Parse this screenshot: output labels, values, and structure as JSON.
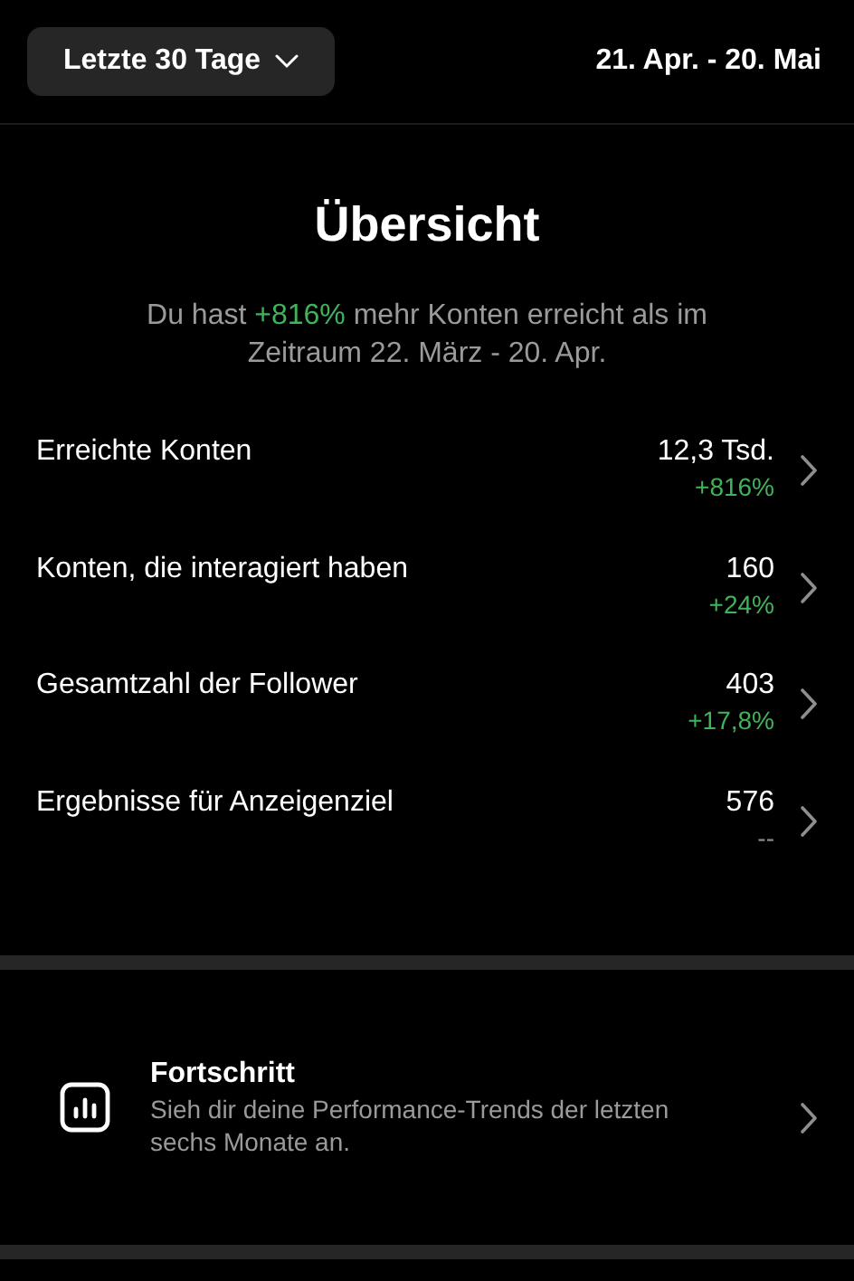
{
  "header": {
    "range_button": "Letzte 30 Tage",
    "date_range": "21. Apr. - 20. Mai"
  },
  "overview": {
    "title": "Übersicht",
    "summary": {
      "before": "Du hast ",
      "highlight": "+816%",
      "after": " mehr Konten erreicht als im Zeitraum 22. März - 20. Apr."
    }
  },
  "metrics": [
    {
      "label": "Erreichte Konten",
      "value": "12,3 Tsd.",
      "change": "+816%",
      "color": "#3fb45a"
    },
    {
      "label": "Konten, die interagiert haben",
      "value": "160",
      "change": "+24%",
      "color": "#3fb45a"
    },
    {
      "label": "Gesamtzahl der Follower",
      "value": "403",
      "change": "+17,8%",
      "color": "#3fb45a"
    },
    {
      "label": "Ergebnisse für Anzeigenziel",
      "value": "576",
      "change": "--",
      "color": "#8e8e8e"
    }
  ],
  "progress": {
    "title": "Fortschritt",
    "description": "Sieh dir deine Performance-Trends der letzten sechs Monate an."
  }
}
